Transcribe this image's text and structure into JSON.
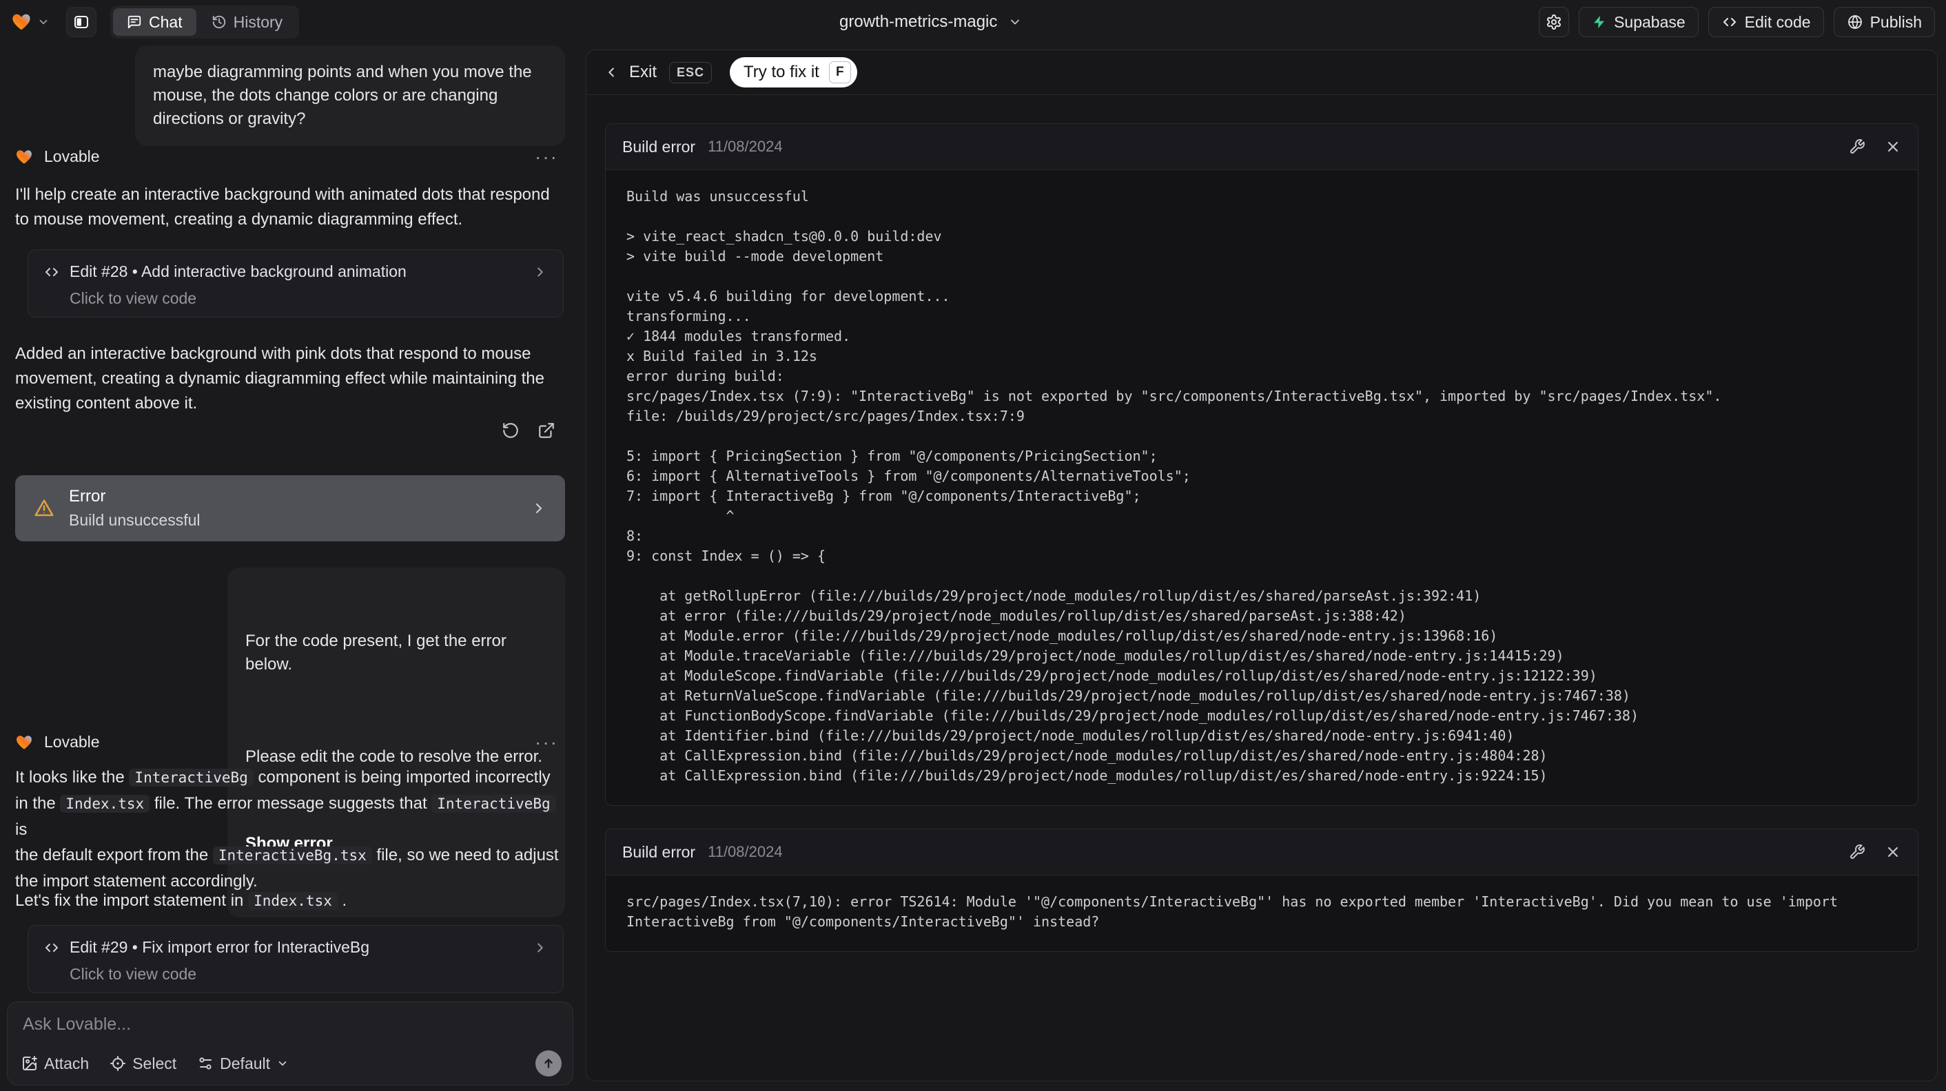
{
  "header": {
    "project_name": "growth-metrics-magic",
    "tab_chat": "Chat",
    "tab_history": "History",
    "supabase_label": "Supabase",
    "edit_code_label": "Edit code",
    "publish_label": "Publish"
  },
  "chat": {
    "assistant_name": "Lovable",
    "more_icon": "···",
    "user_message_1": "maybe diagramming points and when you move the\nmouse, the dots change colors or are changing\ndirections or gravity?",
    "message_1": "I'll help create an interactive background with animated dots that respond\nto mouse movement, creating a dynamic diagramming effect.",
    "edit_card_28": {
      "title": "Edit #28 • Add interactive background animation",
      "subtitle": "Click to view code"
    },
    "message_2": "Added an interactive background with pink dots that respond to mouse\nmovement, creating a dynamic diagramming effect while maintaining the\nexisting content above it.",
    "error_card": {
      "title": "Error",
      "subtitle": "Build unsuccessful"
    },
    "user_message_2": {
      "line1": "For the code present, I get the error below.",
      "line2": "Please edit the code to resolve the error.",
      "action": "Show error"
    },
    "message_3_rich": [
      {
        "text": "It looks like the "
      },
      {
        "text": "InteractiveBg",
        "code": true
      },
      {
        "text": " component is being imported incorrectly\nin the "
      },
      {
        "text": "Index.tsx",
        "code": true
      },
      {
        "text": " file. The error message suggests that "
      },
      {
        "text": "InteractiveBg",
        "code": true
      },
      {
        "text": " is\nthe default export from the "
      },
      {
        "text": "InteractiveBg.tsx",
        "code": true
      },
      {
        "text": " file, so we need to adjust\nthe import statement accordingly."
      }
    ],
    "message_4_rich": [
      {
        "text": "Let's fix the import statement in "
      },
      {
        "text": "Index.tsx",
        "code": true
      },
      {
        "text": " ."
      }
    ],
    "edit_card_29": {
      "title": "Edit #29 • Fix import error for InteractiveBg",
      "subtitle": "Click to view code"
    },
    "composer": {
      "placeholder": "Ask Lovable...",
      "attach_label": "Attach",
      "select_label": "Select",
      "model_label": "Default"
    }
  },
  "error_panel": {
    "exit_label": "Exit",
    "esc_key": "ESC",
    "fix_label": "Try to fix it",
    "fix_key": "F",
    "cards": [
      {
        "title": "Build error",
        "date": "11/08/2024",
        "log": "Build was unsuccessful\n\n> vite_react_shadcn_ts@0.0.0 build:dev\n> vite build --mode development\n\nvite v5.4.6 building for development...\ntransforming...\n✓ 1844 modules transformed.\nx Build failed in 3.12s\nerror during build:\nsrc/pages/Index.tsx (7:9): \"InteractiveBg\" is not exported by \"src/components/InteractiveBg.tsx\", imported by \"src/pages/Index.tsx\".\nfile: /builds/29/project/src/pages/Index.tsx:7:9\n\n5: import { PricingSection } from \"@/components/PricingSection\";\n6: import { AlternativeTools } from \"@/components/AlternativeTools\";\n7: import { InteractiveBg } from \"@/components/InteractiveBg\";\n            ^\n8: \n9: const Index = () => {\n\n    at getRollupError (file:///builds/29/project/node_modules/rollup/dist/es/shared/parseAst.js:392:41)\n    at error (file:///builds/29/project/node_modules/rollup/dist/es/shared/parseAst.js:388:42)\n    at Module.error (file:///builds/29/project/node_modules/rollup/dist/es/shared/node-entry.js:13968:16)\n    at Module.traceVariable (file:///builds/29/project/node_modules/rollup/dist/es/shared/node-entry.js:14415:29)\n    at ModuleScope.findVariable (file:///builds/29/project/node_modules/rollup/dist/es/shared/node-entry.js:12122:39)\n    at ReturnValueScope.findVariable (file:///builds/29/project/node_modules/rollup/dist/es/shared/node-entry.js:7467:38)\n    at FunctionBodyScope.findVariable (file:///builds/29/project/node_modules/rollup/dist/es/shared/node-entry.js:7467:38)\n    at Identifier.bind (file:///builds/29/project/node_modules/rollup/dist/es/shared/node-entry.js:6941:40)\n    at CallExpression.bind (file:///builds/29/project/node_modules/rollup/dist/es/shared/node-entry.js:4804:28)\n    at CallExpression.bind (file:///builds/29/project/node_modules/rollup/dist/es/shared/node-entry.js:9224:15)"
      },
      {
        "title": "Build error",
        "date": "11/08/2024",
        "log": "src/pages/Index.tsx(7,10): error TS2614: Module '\"@/components/InteractiveBg\"' has no exported member 'InteractiveBg'. Did you mean to use 'import\nInteractiveBg from \"@/components/InteractiveBg\"' instead?"
      }
    ]
  },
  "colors": {
    "supabase_green": "#3ecf8e",
    "warning_amber": "#e2a33d",
    "heart_gradient": [
      "#f5a623",
      "#f97316",
      "#93c5fd"
    ]
  }
}
